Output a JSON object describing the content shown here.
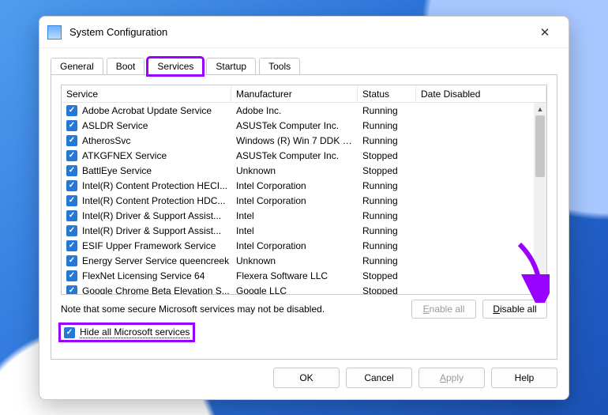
{
  "window": {
    "title": "System Configuration"
  },
  "tabs": [
    "General",
    "Boot",
    "Services",
    "Startup",
    "Tools"
  ],
  "active_tab": 2,
  "columns": [
    "Service",
    "Manufacturer",
    "Status",
    "Date Disabled"
  ],
  "services": [
    {
      "checked": true,
      "name": "Adobe Acrobat Update Service",
      "mfr": "Adobe Inc.",
      "status": "Running"
    },
    {
      "checked": true,
      "name": "ASLDR Service",
      "mfr": "ASUSTek Computer Inc.",
      "status": "Running"
    },
    {
      "checked": true,
      "name": "AtherosSvc",
      "mfr": "Windows (R) Win 7 DDK p...",
      "status": "Running"
    },
    {
      "checked": true,
      "name": "ATKGFNEX Service",
      "mfr": "ASUSTek Computer Inc.",
      "status": "Stopped"
    },
    {
      "checked": true,
      "name": "BattlEye Service",
      "mfr": "Unknown",
      "status": "Stopped"
    },
    {
      "checked": true,
      "name": "Intel(R) Content Protection HECI...",
      "mfr": "Intel Corporation",
      "status": "Running"
    },
    {
      "checked": true,
      "name": "Intel(R) Content Protection HDC...",
      "mfr": "Intel Corporation",
      "status": "Running"
    },
    {
      "checked": true,
      "name": "Intel(R) Driver & Support Assist...",
      "mfr": "Intel",
      "status": "Running"
    },
    {
      "checked": true,
      "name": "Intel(R) Driver & Support Assist...",
      "mfr": "Intel",
      "status": "Running"
    },
    {
      "checked": true,
      "name": "ESIF Upper Framework Service",
      "mfr": "Intel Corporation",
      "status": "Running"
    },
    {
      "checked": true,
      "name": "Energy Server Service queencreek",
      "mfr": "Unknown",
      "status": "Running"
    },
    {
      "checked": true,
      "name": "FlexNet Licensing Service 64",
      "mfr": "Flexera Software LLC",
      "status": "Stopped"
    },
    {
      "checked": true,
      "name": "Google Chrome Beta Elevation S...",
      "mfr": "Google LLC",
      "status": "Stopped"
    }
  ],
  "note_text": "Note that some secure Microsoft services may not be disabled.",
  "buttons": {
    "enable_all": "Enable all",
    "disable_all": "Disable all",
    "ok": "OK",
    "cancel": "Cancel",
    "apply": "Apply",
    "help": "Help"
  },
  "hide_ms": {
    "checked": true,
    "label": "Hide all Microsoft services"
  },
  "highlight_color": "#9800ff"
}
